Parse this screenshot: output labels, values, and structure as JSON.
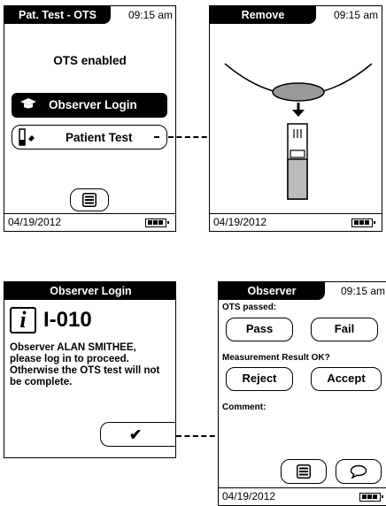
{
  "screen1": {
    "title": "Pat. Test - OTS",
    "time": "09:15 am",
    "heading": "OTS enabled",
    "observer_login_label": "Observer Login",
    "patient_test_label": "Patient Test",
    "date": "04/19/2012"
  },
  "screen2": {
    "title": "Remove",
    "time": "09:15 am",
    "date": "04/19/2012"
  },
  "screen3": {
    "title": "Observer Login",
    "code": "I-010",
    "message": "Observer ALAN SMITHEE, please log in to proceed. Otherwise the OTS test will not be complete.",
    "confirm_glyph": "✔"
  },
  "screen4": {
    "title": "Observer",
    "time": "09:15 am",
    "ots_passed_label": "OTS passed:",
    "pass_label": "Pass",
    "fail_label": "Fail",
    "measurement_label": "Measurement Result OK?",
    "reject_label": "Reject",
    "accept_label": "Accept",
    "comment_label": "Comment:",
    "date": "04/19/2012"
  }
}
